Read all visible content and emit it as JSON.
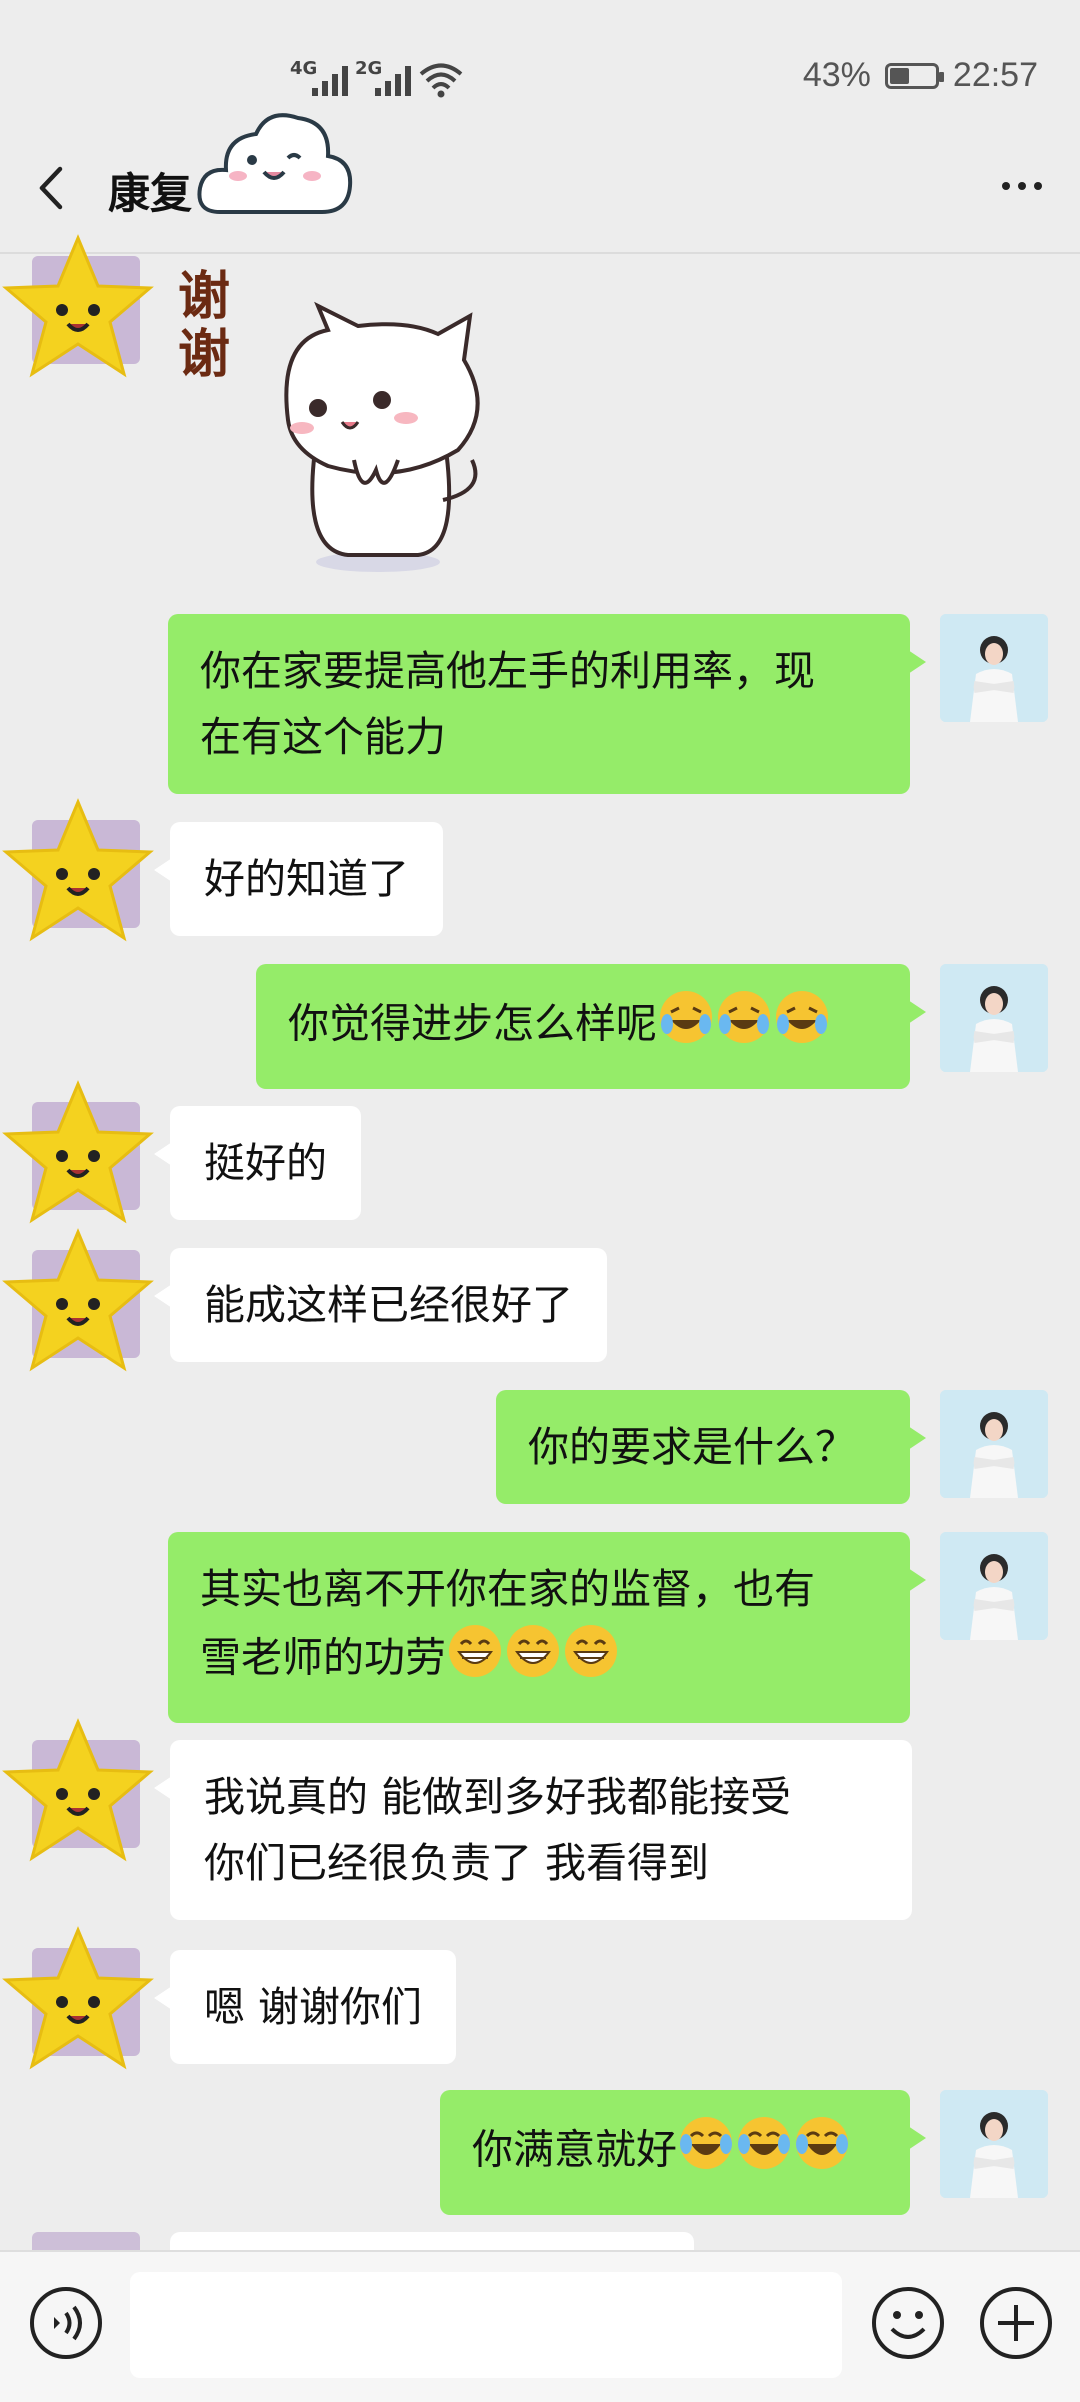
{
  "status_bar": {
    "network_1": "4G",
    "network_2": "2G",
    "battery": "43%",
    "time": "22:57"
  },
  "nav": {
    "title": "康复"
  },
  "sticker_message": {
    "caption": "谢谢"
  },
  "messages": [
    {
      "side": "me",
      "lines": [
        "你在家要提高他左手的利用率，现",
        "在有这个能力"
      ]
    },
    {
      "side": "them",
      "lines": [
        "好的知道了"
      ]
    },
    {
      "side": "me",
      "lines": [
        "你觉得进步怎么样呢"
      ],
      "emoji": "laugh-cry"
    },
    {
      "side": "them",
      "lines": [
        "挺好的"
      ]
    },
    {
      "side": "them",
      "lines": [
        "能成这样已经很好了"
      ]
    },
    {
      "side": "me",
      "lines": [
        "你的要求是什么？"
      ]
    },
    {
      "side": "me",
      "lines": [
        "其实也离不开你在家的监督，也有",
        "雪老师的功劳"
      ],
      "emoji": "grin"
    },
    {
      "side": "them",
      "lines": [
        "我说真的 能做到多好我都能接受",
        "你们已经很负责了 我看得到"
      ]
    },
    {
      "side": "them",
      "lines": [
        "嗯 谢谢你们"
      ]
    },
    {
      "side": "me",
      "lines": [
        "你满意就好"
      ],
      "emoji": "joy"
    }
  ],
  "input_bar": {
    "input_value": "",
    "icons": [
      "voice-icon",
      "emoji-icon",
      "plus-icon"
    ]
  },
  "colors": {
    "background": "#ededed",
    "my_bubble": "#95ec69",
    "their_bubble": "#ffffff"
  }
}
